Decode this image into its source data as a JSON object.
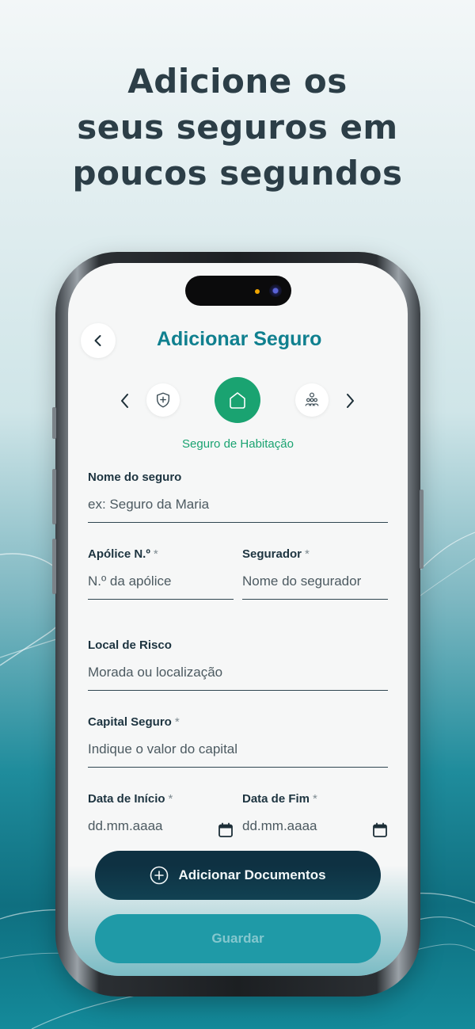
{
  "headline": [
    "Adicione os",
    "seus seguros em",
    "poucos segundos"
  ],
  "colors": {
    "brand_teal": "#10808f",
    "active_green": "#1aa371",
    "dark_navy": "#0e3142",
    "save_teal": "#1f9aa7"
  },
  "app": {
    "title": "Adicionar Seguro",
    "back_icon": "chevron-left-icon"
  },
  "categories": {
    "items": [
      {
        "icon": "shield-plus-icon",
        "active": false
      },
      {
        "icon": "home-icon",
        "active": true
      },
      {
        "icon": "family-group-icon",
        "active": false
      }
    ],
    "active_label": "Seguro de Habitação"
  },
  "form": {
    "nome": {
      "label": "Nome do seguro",
      "placeholder": "ex: Seguro da Maria"
    },
    "apolice": {
      "label": "Apólice N.º",
      "required": "*",
      "placeholder": "N.º da apólice"
    },
    "segurador": {
      "label": "Segurador",
      "required": "*",
      "placeholder": "Nome do segurador"
    },
    "local": {
      "label": "Local de Risco",
      "placeholder": "Morada ou localização"
    },
    "capital": {
      "label": "Capital Seguro",
      "required": "*",
      "placeholder": "Indique o valor do capital"
    },
    "data_inicio": {
      "label": "Data de Início",
      "required": "*",
      "placeholder": "dd.mm.aaaa"
    },
    "data_fim": {
      "label": "Data de Fim",
      "required": "*",
      "placeholder": "dd.mm.aaaa"
    }
  },
  "buttons": {
    "add_docs": "Adicionar Documentos",
    "save": "Guardar"
  }
}
